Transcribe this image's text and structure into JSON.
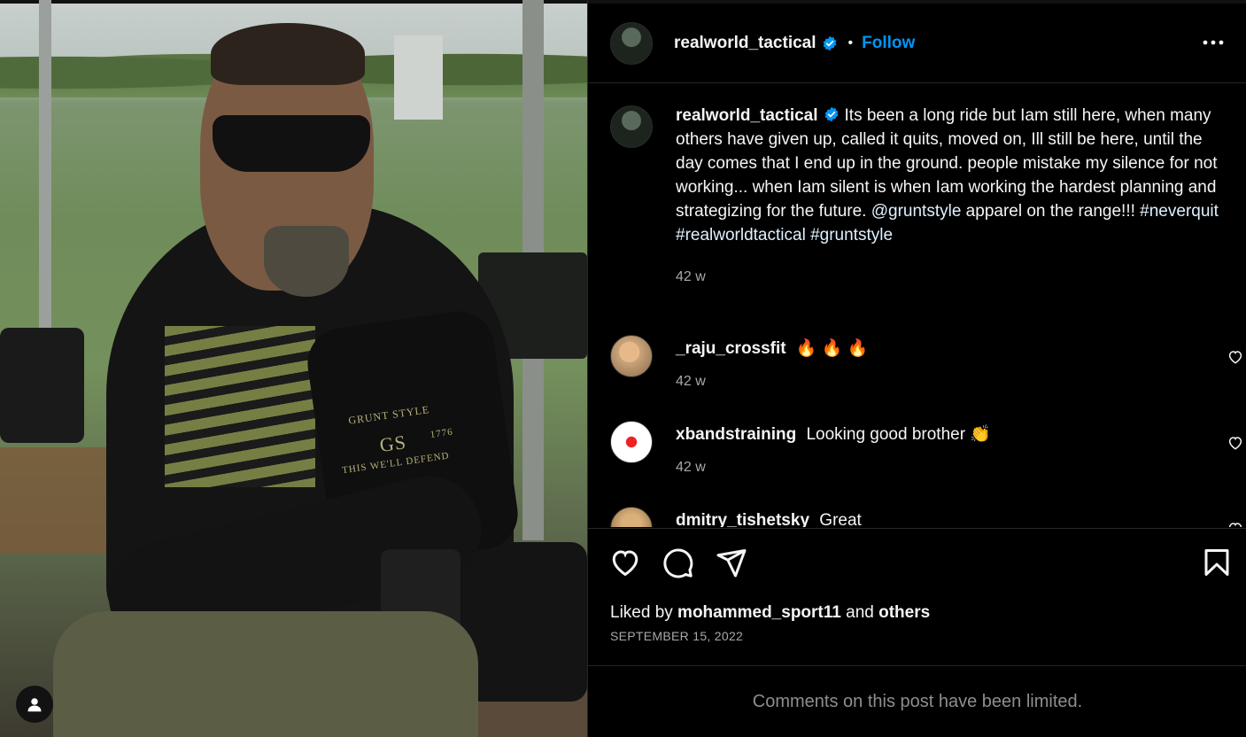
{
  "post": {
    "username": "realworld_tactical",
    "follow_label": "Follow",
    "separator": "•"
  },
  "caption": {
    "username": "realworld_tactical",
    "text_1": "Its been a long ride but Iam still here, when many others have given up, called it quits, moved on, Ill still be here, until the day comes that I end up in the ground. people mistake my silence for not working... when Iam silent is when Iam working the hardest planning and strategizing for the future. ",
    "mention": "@gruntstyle",
    "text_2": " apparel on the range!!! ",
    "tag_1": "#neverquit",
    "tag_2": "#realworldtactical",
    "tag_3": "#gruntstyle",
    "time": "42 w"
  },
  "comments": [
    {
      "username": "_raju_crossfit",
      "text": "🔥 🔥 🔥",
      "time": "42 w"
    },
    {
      "username": "xbandstraining",
      "text": "Looking good brother 👏",
      "time": "42 w"
    },
    {
      "username": "dmitry_tishetsky",
      "text": "Great",
      "time": ""
    }
  ],
  "likes": {
    "prefix": "Liked by ",
    "user": "mohammed_sport11",
    "middle": " and ",
    "others": "others"
  },
  "date": "SEPTEMBER 15, 2022",
  "limited_notice": "Comments on this post have been limited.",
  "photo": {
    "shirt_brand": "GRUNT STYLE",
    "shirt_initials": "GS",
    "shirt_year": "1776",
    "shirt_tagline": "THIS WE'LL DEFEND"
  },
  "colors": {
    "background": "#000000",
    "follow_blue": "#0095f6",
    "verified_blue": "#0095f6",
    "link": "#e0f1ff",
    "muted": "#a8a8a8",
    "divider": "#262626"
  }
}
